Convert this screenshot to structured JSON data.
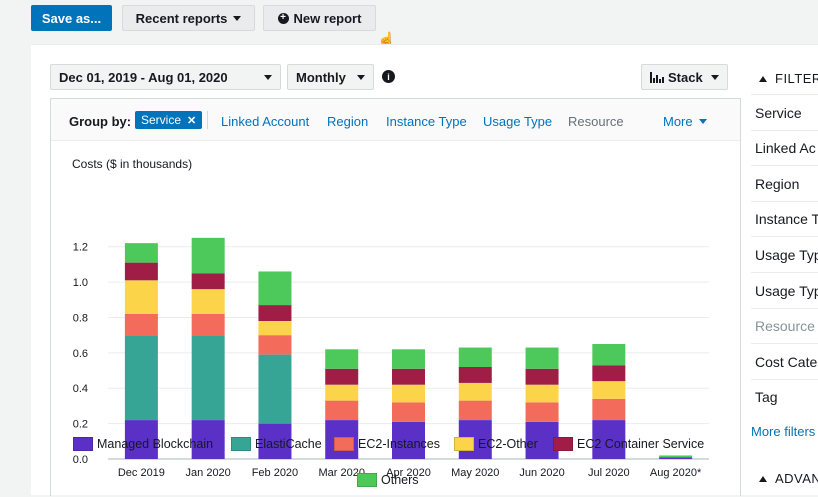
{
  "toolbar": {
    "save_label": "Save as...",
    "recent_label": "Recent reports",
    "new_label": "New report"
  },
  "controls": {
    "date_range": "Dec 01, 2019 - Aug 01, 2020",
    "granularity": "Monthly",
    "chart_style": "Stack"
  },
  "group_by": {
    "label": "Group by:",
    "selected": "Service",
    "options": [
      "Linked Account",
      "Region",
      "Instance Type",
      "Usage Type"
    ],
    "disabled_option": "Resource",
    "more_label": "More"
  },
  "filters": {
    "title": "FILTER",
    "items": [
      "Service",
      "Linked Ac",
      "Region",
      "Instance T",
      "Usage Typ",
      "Usage Typ",
      "Resource",
      "Cost Cate",
      "Tag"
    ],
    "disabled_item": "Resource",
    "more_label": "More filters",
    "advanced_label": "ADVAN"
  },
  "colors": {
    "Managed Blockchain": "#5a30c7",
    "ElastiCache": "#36a596",
    "EC2-Instances": "#f26b5b",
    "EC2-Other": "#fbd44a",
    "EC2 Container Service": "#a01e45",
    "Others": "#4dc85b"
  },
  "chart_data": {
    "type": "bar",
    "stacked": true,
    "ylabel": "Costs ($ in thousands)",
    "xlabel": "",
    "ylim": [
      0,
      1.3
    ],
    "yticks": [
      "0.0",
      "0.2",
      "0.4",
      "0.6",
      "0.8",
      "1.0",
      "1.2"
    ],
    "categories": [
      "Dec 2019",
      "Jan 2020",
      "Feb 2020",
      "Mar 2020",
      "Apr 2020",
      "May 2020",
      "Jun 2020",
      "Jul 2020",
      "Aug 2020*"
    ],
    "series": [
      {
        "name": "Managed Blockchain",
        "values": [
          0.22,
          0.22,
          0.2,
          0.22,
          0.21,
          0.22,
          0.21,
          0.22,
          0.01
        ]
      },
      {
        "name": "ElastiCache",
        "values": [
          0.48,
          0.48,
          0.39,
          0.0,
          0.0,
          0.0,
          0.0,
          0.0,
          0.0
        ]
      },
      {
        "name": "EC2-Instances",
        "values": [
          0.12,
          0.12,
          0.11,
          0.11,
          0.11,
          0.11,
          0.11,
          0.12,
          0.0
        ]
      },
      {
        "name": "EC2-Other",
        "values": [
          0.19,
          0.14,
          0.08,
          0.09,
          0.1,
          0.1,
          0.1,
          0.1,
          0.0
        ]
      },
      {
        "name": "EC2 Container Service",
        "values": [
          0.1,
          0.09,
          0.09,
          0.09,
          0.09,
          0.09,
          0.09,
          0.09,
          0.0
        ]
      },
      {
        "name": "Others",
        "values": [
          0.11,
          0.2,
          0.19,
          0.11,
          0.11,
          0.11,
          0.12,
          0.12,
          0.01
        ]
      }
    ]
  }
}
